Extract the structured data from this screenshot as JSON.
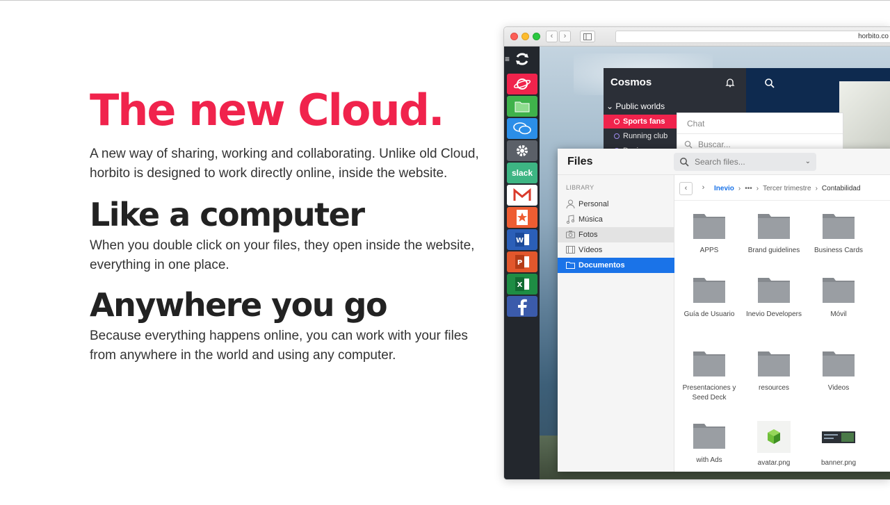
{
  "hero": {
    "title": "The new Cloud.",
    "intro": "A new way of sharing, working and collaborating. Unlike old Cloud, horbito is designed to work directly online, inside the website."
  },
  "sections": [
    {
      "title": "Like a computer",
      "text": "When you double click on your files, they open inside the website, everything in one place."
    },
    {
      "title": "Anywhere you go",
      "text": "Because everything happens online, you can work with your files from anywhere in the world and using any computer."
    }
  ],
  "browser": {
    "url": "horbito.co"
  },
  "dock": {
    "apps": [
      {
        "name": "cosmos-app",
        "icon": "planet-icon",
        "color": "#f0234c"
      },
      {
        "name": "files-app",
        "icon": "folder-icon",
        "color": "#3fb24b"
      },
      {
        "name": "chat-app",
        "icon": "chat-bubbles-icon",
        "color": "#2b8ee8"
      },
      {
        "name": "settings-app",
        "icon": "gear-icon",
        "color": "#5b6068"
      },
      {
        "name": "slack-app",
        "icon": "slack-icon",
        "label": "slack",
        "color": "#3db583"
      },
      {
        "name": "gmail-app",
        "icon": "gmail-icon",
        "color": "#ffffff"
      },
      {
        "name": "bookmarks-app",
        "icon": "star-bookmark-icon",
        "color": "#ee5d32"
      },
      {
        "name": "word-app",
        "icon": "word-icon",
        "color": "#2b5fb8"
      },
      {
        "name": "powerpoint-app",
        "icon": "powerpoint-icon",
        "color": "#e2572c"
      },
      {
        "name": "excel-app",
        "icon": "excel-icon",
        "color": "#1e8d44"
      },
      {
        "name": "facebook-app",
        "icon": "facebook-icon",
        "color": "#3b5bab"
      }
    ]
  },
  "cosmos": {
    "title": "Cosmos",
    "section": "Public worlds",
    "rooms": [
      "Sports fans",
      "Running club",
      "Design"
    ]
  },
  "chat": {
    "header": "Chat",
    "search_placeholder": "Buscar..."
  },
  "files": {
    "title": "Files",
    "search_placeholder": "Search files...",
    "library_label": "LIBRARY",
    "sidebar": [
      {
        "label": "Personal",
        "icon": "person-icon"
      },
      {
        "label": "Música",
        "icon": "music-note-icon"
      },
      {
        "label": "Fotos",
        "icon": "camera-icon"
      },
      {
        "label": "Vídeos",
        "icon": "film-icon"
      },
      {
        "label": "Documentos",
        "icon": "folder-icon"
      }
    ],
    "breadcrumb": {
      "root": "Inevio",
      "ellipsis": "•••",
      "middle": "Tercer trimestre",
      "current": "Contabilidad"
    },
    "items": [
      {
        "name": "APPS",
        "kind": "folder"
      },
      {
        "name": "Brand guidelines",
        "kind": "folder"
      },
      {
        "name": "Business Cards",
        "kind": "folder"
      },
      {
        "name": "Guía de Usuario",
        "kind": "folder"
      },
      {
        "name": "Inevio Developers",
        "kind": "folder"
      },
      {
        "name": "Móvil",
        "kind": "folder"
      },
      {
        "name": "Presentaciones y Seed Deck",
        "kind": "folder"
      },
      {
        "name": "resources",
        "kind": "folder"
      },
      {
        "name": "Videos",
        "kind": "folder"
      },
      {
        "name": "with Ads",
        "kind": "folder"
      },
      {
        "name": "avatar.png",
        "kind": "image"
      },
      {
        "name": "banner.png",
        "kind": "image"
      }
    ]
  },
  "colors": {
    "accent": "#f0234c",
    "selection": "#1a73e8",
    "dock": "#23272d"
  }
}
